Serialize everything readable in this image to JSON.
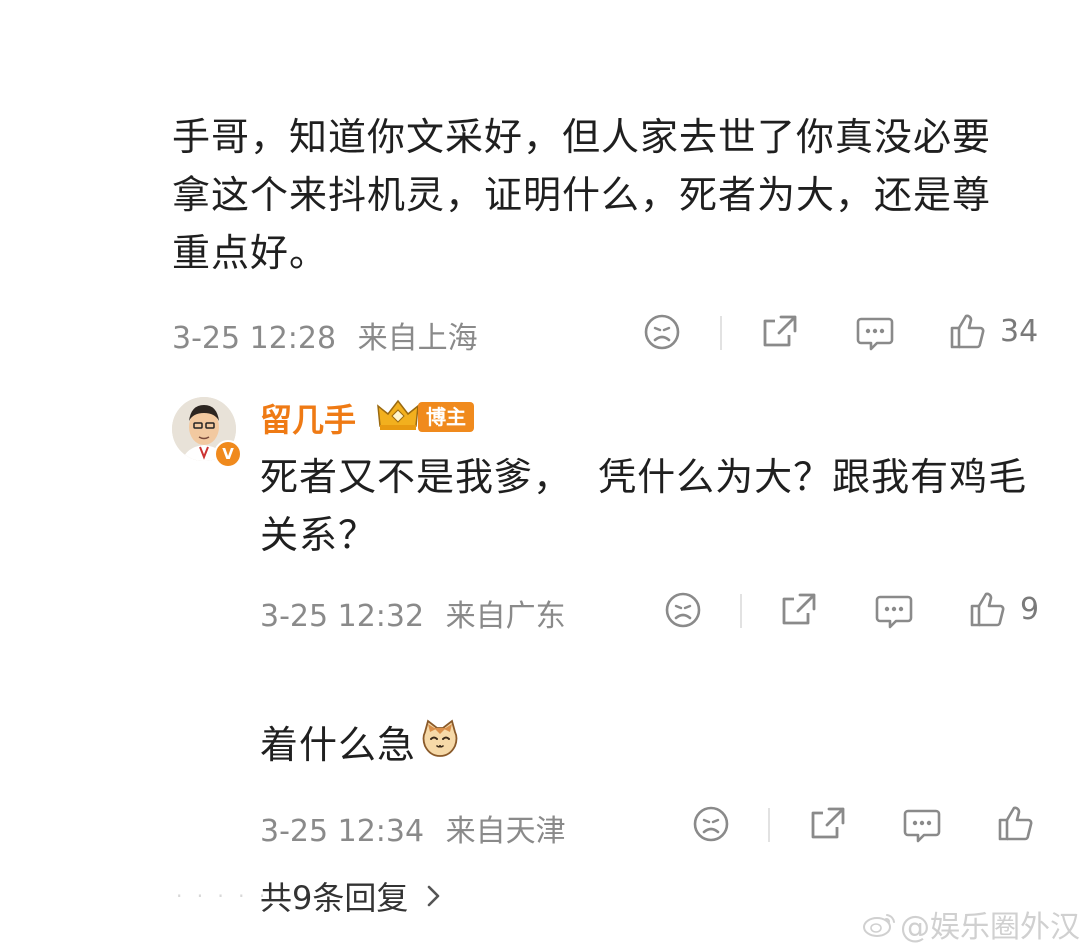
{
  "comment": {
    "text": "手哥，知道你文采好，但人家去世了你真没必要拿这个来抖机灵，证明什么，死者为大，还是尊重点好。",
    "lines": [
      "手哥，知道你文采好，但人家去世了你真没必要",
      "拿这个来抖机灵，证明什么，死者为大，还是尊",
      "重点好。"
    ],
    "time": "3-25 12:28",
    "location": "来自上海",
    "likes": "34"
  },
  "reply1": {
    "username": "留几手",
    "badge": "博主",
    "lines": [
      "死者又不是我爹，  凭什么为大？跟我有鸡毛",
      "关系？"
    ],
    "time": "3-25 12:32",
    "location": "来自广东",
    "likes": "9"
  },
  "reply2": {
    "text": "着什么急",
    "emoji": "cat-emoji",
    "time": "3-25 12:34",
    "location": "来自天津"
  },
  "footer": {
    "more_replies": "共9条回复",
    "watermark": "@娱乐圈外汉"
  },
  "colors": {
    "accent": "#ef7a14",
    "meta": "#8a8a8a",
    "text": "#1f1f1f"
  }
}
